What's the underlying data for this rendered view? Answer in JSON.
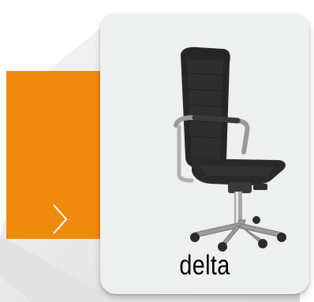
{
  "product": {
    "name": "delta",
    "image_icon": "office-chair-image"
  },
  "navigation": {
    "next_icon": "chevron-right-icon",
    "accent_color": "#f08a0c"
  },
  "colors": {
    "card_background": "#eef0ef",
    "shadow": "#cfcfcf"
  }
}
